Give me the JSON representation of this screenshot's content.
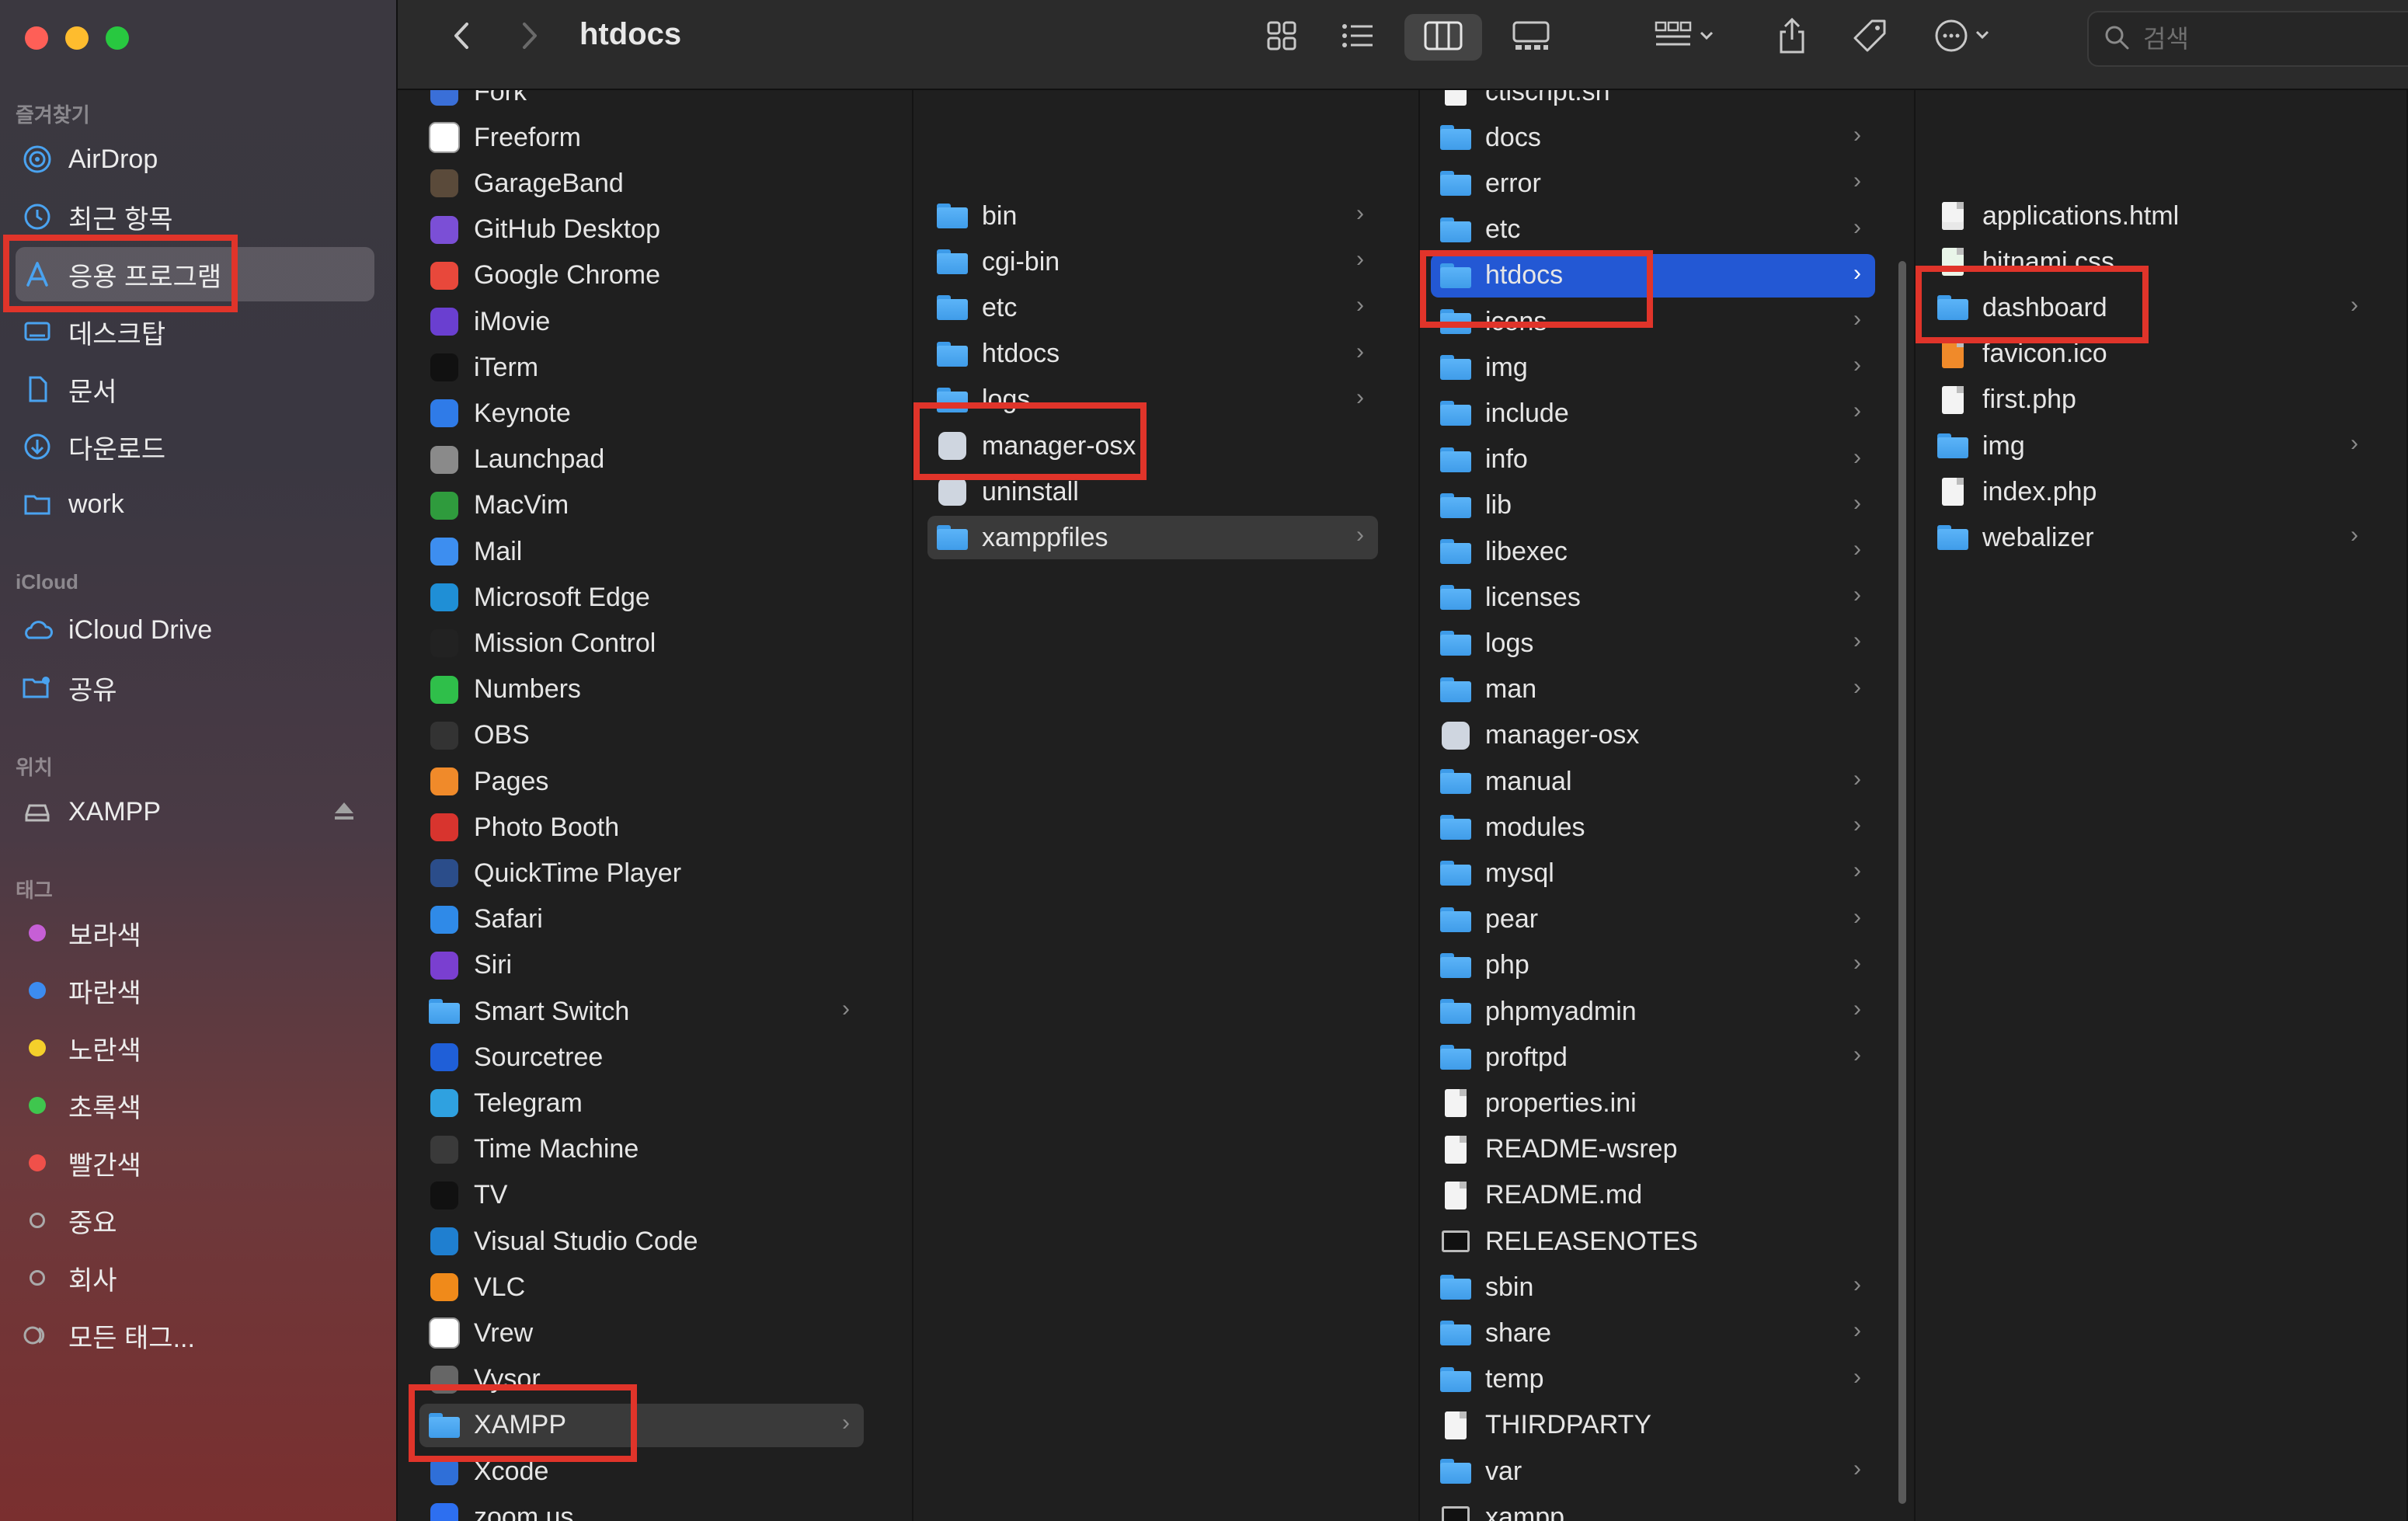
{
  "window": {
    "title": "htdocs",
    "traffic_lights": {
      "close": "#fe5f57",
      "minimize": "#febc2e",
      "zoom": "#28c840"
    }
  },
  "sidebar": {
    "favorites_header": "즐겨찾기",
    "favorites": [
      {
        "label": "AirDrop",
        "icon": "airdrop-icon"
      },
      {
        "label": "최근 항목",
        "icon": "clock-icon"
      },
      {
        "label": "응용 프로그램",
        "icon": "applications-icon",
        "selected": true
      },
      {
        "label": "데스크탑",
        "icon": "desktop-icon"
      },
      {
        "label": "문서",
        "icon": "document-icon"
      },
      {
        "label": "다운로드",
        "icon": "download-icon"
      },
      {
        "label": "work",
        "icon": "folder-icon"
      }
    ],
    "icloud_header": "iCloud",
    "icloud": [
      {
        "label": "iCloud Drive",
        "icon": "cloud-icon"
      },
      {
        "label": "공유",
        "icon": "shared-folder-icon"
      }
    ],
    "locations_header": "위치",
    "locations": [
      {
        "label": "XAMPP",
        "icon": "drive-icon",
        "eject": true
      }
    ],
    "tags_header": "태그",
    "tags": [
      {
        "label": "보라색",
        "color": "#c65fd6"
      },
      {
        "label": "파란색",
        "color": "#3c8cf0"
      },
      {
        "label": "노란색",
        "color": "#f4d02b"
      },
      {
        "label": "초록색",
        "color": "#3fc64e"
      },
      {
        "label": "빨간색",
        "color": "#f0504a"
      },
      {
        "label": "중요",
        "color": "ring"
      },
      {
        "label": "회사",
        "color": "ring"
      },
      {
        "label": "모든 태그...",
        "color": "all"
      }
    ]
  },
  "toolbar": {
    "back": "back-icon",
    "forward": "forward-icon",
    "views": [
      "icon-view-icon",
      "list-view-icon",
      "column-view-icon",
      "gallery-view-icon"
    ],
    "active_view": "column-view-icon",
    "group": "group-icon",
    "share": "share-icon",
    "tag": "tag-icon",
    "more": "more-icon",
    "search_placeholder": "검색"
  },
  "columns": [
    {
      "name": "applications",
      "items": [
        {
          "label": "Fork",
          "color": "#3a6fd8"
        },
        {
          "label": "Freeform",
          "color": "#ffffff"
        },
        {
          "label": "GarageBand",
          "color": "#5a4a3a"
        },
        {
          "label": "GitHub Desktop",
          "color": "#7b4fd6"
        },
        {
          "label": "Google Chrome",
          "color": "#e8483b"
        },
        {
          "label": "iMovie",
          "color": "#6a3fd0"
        },
        {
          "label": "iTerm",
          "color": "#111111"
        },
        {
          "label": "Keynote",
          "color": "#2f7be8"
        },
        {
          "label": "Launchpad",
          "color": "#8a8a8a"
        },
        {
          "label": "MacVim",
          "color": "#2f9b3d"
        },
        {
          "label": "Mail",
          "color": "#3d8ef0"
        },
        {
          "label": "Microsoft Edge",
          "color": "#1f8fd6"
        },
        {
          "label": "Mission Control",
          "color": "#222222"
        },
        {
          "label": "Numbers",
          "color": "#2fbf4a"
        },
        {
          "label": "OBS",
          "color": "#333333"
        },
        {
          "label": "Pages",
          "color": "#f08a2a"
        },
        {
          "label": "Photo Booth",
          "color": "#d8342e"
        },
        {
          "label": "QuickTime Player",
          "color": "#2b4d8a"
        },
        {
          "label": "Safari",
          "color": "#2f8ae8"
        },
        {
          "label": "Siri",
          "color": "#7a3fd0"
        },
        {
          "label": "Smart Switch",
          "color": "folder",
          "chevron": true
        },
        {
          "label": "Sourcetree",
          "color": "#1f5fd8"
        },
        {
          "label": "Telegram",
          "color": "#2fa1e0"
        },
        {
          "label": "Time Machine",
          "color": "#3a3a3a"
        },
        {
          "label": "TV",
          "color": "#111111"
        },
        {
          "label": "Visual Studio Code",
          "color": "#1f7fd0"
        },
        {
          "label": "VLC",
          "color": "#f08a1a"
        },
        {
          "label": "Vrew",
          "color": "#ffffff"
        },
        {
          "label": "Vysor",
          "color": "#666666"
        },
        {
          "label": "XAMPP",
          "color": "folder",
          "chevron": true,
          "selected": true
        },
        {
          "label": "Xcode",
          "color": "#2f6fd8"
        },
        {
          "label": "zoom.us",
          "color": "#2d6ff0"
        }
      ]
    },
    {
      "name": "xampp",
      "items": [
        {
          "label": "bin",
          "kind": "folder",
          "chevron": true
        },
        {
          "label": "cgi-bin",
          "kind": "folder",
          "chevron": true
        },
        {
          "label": "etc",
          "kind": "folder",
          "chevron": true
        },
        {
          "label": "htdocs",
          "kind": "folder",
          "chevron": true
        },
        {
          "label": "logs",
          "kind": "folder",
          "chevron": true
        },
        {
          "label": "manager-osx",
          "kind": "app"
        },
        {
          "label": "uninstall",
          "kind": "app"
        },
        {
          "label": "xamppfiles",
          "kind": "folder",
          "chevron": true,
          "selected": true
        }
      ]
    },
    {
      "name": "xamppfiles",
      "items": [
        {
          "label": "ctlscript.sh",
          "kind": "doc"
        },
        {
          "label": "docs",
          "kind": "folder",
          "chevron": true
        },
        {
          "label": "error",
          "kind": "folder",
          "chevron": true
        },
        {
          "label": "etc",
          "kind": "folder",
          "chevron": true
        },
        {
          "label": "htdocs",
          "kind": "folder",
          "chevron": true,
          "selected": true
        },
        {
          "label": "icons",
          "kind": "folder",
          "chevron": true
        },
        {
          "label": "img",
          "kind": "folder",
          "chevron": true
        },
        {
          "label": "include",
          "kind": "folder",
          "chevron": true
        },
        {
          "label": "info",
          "kind": "folder",
          "chevron": true
        },
        {
          "label": "lib",
          "kind": "folder",
          "chevron": true
        },
        {
          "label": "libexec",
          "kind": "folder",
          "chevron": true
        },
        {
          "label": "licenses",
          "kind": "folder",
          "chevron": true
        },
        {
          "label": "logs",
          "kind": "folder",
          "chevron": true
        },
        {
          "label": "man",
          "kind": "folder",
          "chevron": true
        },
        {
          "label": "manager-osx",
          "kind": "app"
        },
        {
          "label": "manual",
          "kind": "folder",
          "chevron": true
        },
        {
          "label": "modules",
          "kind": "folder",
          "chevron": true
        },
        {
          "label": "mysql",
          "kind": "folder",
          "chevron": true
        },
        {
          "label": "pear",
          "kind": "folder",
          "chevron": true
        },
        {
          "label": "php",
          "kind": "folder",
          "chevron": true
        },
        {
          "label": "phpmyadmin",
          "kind": "folder",
          "chevron": true
        },
        {
          "label": "proftpd",
          "kind": "folder",
          "chevron": true
        },
        {
          "label": "properties.ini",
          "kind": "doc"
        },
        {
          "label": "README-wsrep",
          "kind": "doc"
        },
        {
          "label": "README.md",
          "kind": "doc"
        },
        {
          "label": "RELEASENOTES",
          "kind": "exec"
        },
        {
          "label": "sbin",
          "kind": "folder",
          "chevron": true
        },
        {
          "label": "share",
          "kind": "folder",
          "chevron": true
        },
        {
          "label": "temp",
          "kind": "folder",
          "chevron": true
        },
        {
          "label": "THIRDPARTY",
          "kind": "doc"
        },
        {
          "label": "var",
          "kind": "folder",
          "chevron": true
        },
        {
          "label": "xampp",
          "kind": "exec"
        }
      ]
    },
    {
      "name": "htdocs",
      "items": [
        {
          "label": "applications.html",
          "kind": "html"
        },
        {
          "label": "bitnami.css",
          "kind": "css"
        },
        {
          "label": "dashboard",
          "kind": "folder",
          "chevron": true
        },
        {
          "label": "favicon.ico",
          "kind": "ico"
        },
        {
          "label": "first.php",
          "kind": "php",
          "highlighted": true
        },
        {
          "label": "img",
          "kind": "folder",
          "chevron": true
        },
        {
          "label": "index.php",
          "kind": "php"
        },
        {
          "label": "webalizer",
          "kind": "folder",
          "chevron": true
        }
      ]
    }
  ],
  "annotations": {
    "highlight_color": "#e0342a"
  }
}
